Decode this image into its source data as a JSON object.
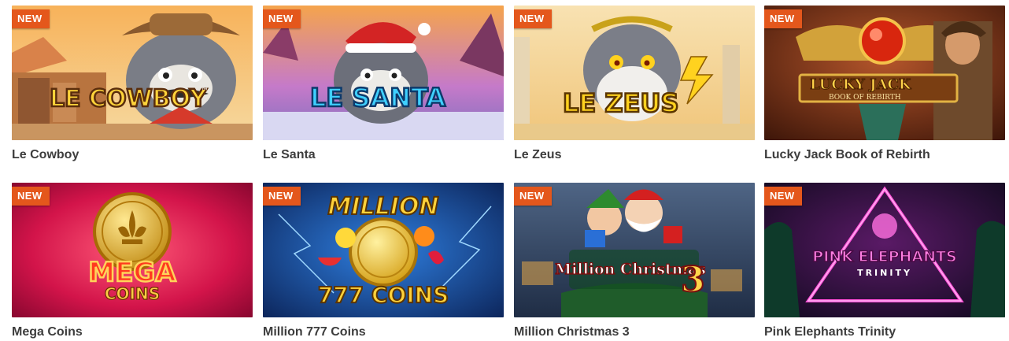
{
  "badge_label": "NEW",
  "games": [
    {
      "title": "Le Cowboy",
      "logo_text": "LE COWBOY",
      "logo_suffix": "™"
    },
    {
      "title": "Le Santa",
      "logo_text": "LE SANTA"
    },
    {
      "title": "Le Zeus",
      "logo_text": "LE ZEUS"
    },
    {
      "title": "Lucky Jack Book of Rebirth",
      "logo_text": "LUCKY JACK",
      "logo_subtext": "BOOK OF REBIRTH"
    },
    {
      "title": "Mega Coins",
      "logo_text": "MEGA",
      "logo_subtext": "COINS"
    },
    {
      "title": "Million 777 Coins",
      "logo_text": "MILLION",
      "logo_subtext": "777 COINS"
    },
    {
      "title": "Million Christmas 3",
      "logo_text": "Million Christmas",
      "logo_number": "3"
    },
    {
      "title": "Pink Elephants Trinity",
      "logo_text": "PINK ELEPHANTS",
      "logo_subtext": "TRINITY"
    }
  ],
  "colors": {
    "badge": "#e4571c",
    "title_text": "#3d3d3d",
    "background": "#ffffff"
  }
}
